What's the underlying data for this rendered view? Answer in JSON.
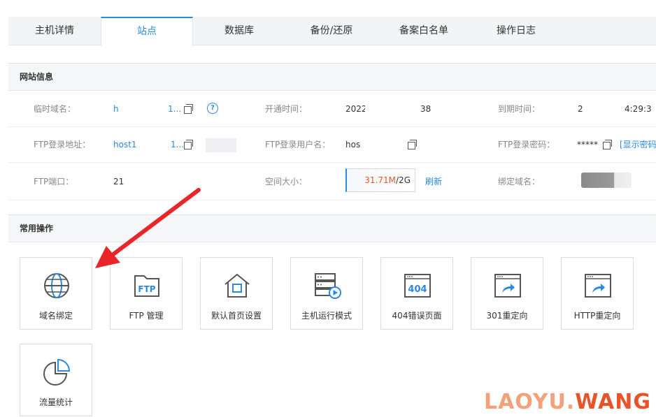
{
  "tabs": [
    {
      "label": "主机详情",
      "active": false
    },
    {
      "label": "站点",
      "active": true
    },
    {
      "label": "数据库",
      "active": false
    },
    {
      "label": "备份/还原",
      "active": false
    },
    {
      "label": "备案白名单",
      "active": false
    },
    {
      "label": "操作日志",
      "active": false
    }
  ],
  "site_info": {
    "title": "网站信息",
    "temp_domain_label": "临时域名：",
    "temp_domain_value_start": "h",
    "temp_domain_value_end": "1...",
    "open_time_label": "开通时间：",
    "open_time_value_start": "2022",
    "open_time_value_end": "38",
    "expire_time_label": "到期时间：",
    "expire_time_value_start": "2",
    "expire_time_value_end": "4:29:3",
    "ftp_addr_label": "FTP登录地址：",
    "ftp_addr_value": "host1",
    "ftp_addr_value_end": "1...",
    "ftp_user_label": "FTP登录用户名：",
    "ftp_user_value": "hos",
    "ftp_pwd_label": "FTP登录密码：",
    "ftp_pwd_value": "*****",
    "show_pwd_link": "[显示密码",
    "ftp_port_label": "FTP端口：",
    "ftp_port_value": "21",
    "space_label": "空间大小：",
    "space_used": "31.71M",
    "space_total": "/2G",
    "refresh_link": "刷新",
    "bind_domain_label": "绑定域名："
  },
  "common_ops": {
    "title": "常用操作",
    "tiles": [
      {
        "label": "域名绑定",
        "icon": "globe-icon"
      },
      {
        "label": "FTP 管理",
        "icon": "ftp-folder-icon"
      },
      {
        "label": "默认首页设置",
        "icon": "home-icon"
      },
      {
        "label": "主机运行模式",
        "icon": "server-run-icon"
      },
      {
        "label": "404错误页面",
        "icon": "page-404-icon"
      },
      {
        "label": "301重定向",
        "icon": "redirect-301-icon"
      },
      {
        "label": "HTTP重定向",
        "icon": "http-redirect-icon"
      },
      {
        "label": "流量统计",
        "icon": "pie-chart-icon"
      }
    ],
    "icon_text_ftp": "FTP",
    "icon_text_404": "404"
  },
  "watermark": {
    "part1": "LAOYU.",
    "part2": "WANG"
  },
  "colors": {
    "accent": "#2a8ae0",
    "warning": "#e8542a",
    "arrow": "#e8262a"
  }
}
